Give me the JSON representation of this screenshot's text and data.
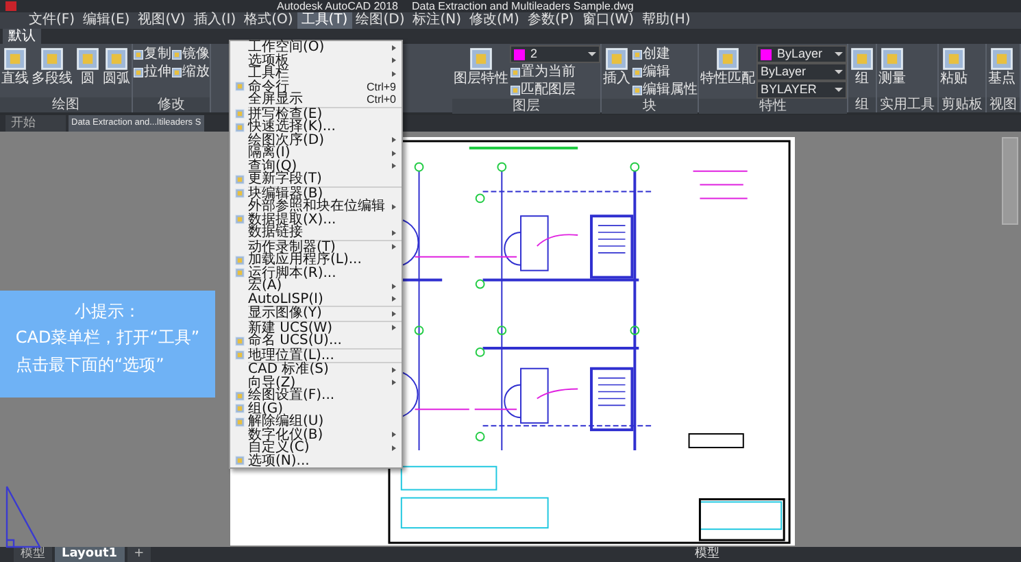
{
  "title_bar": {
    "app": "Autodesk AutoCAD 2018",
    "document": "Data Extraction and Multileaders Sample.dwg"
  },
  "menu_bar": [
    {
      "label": "文件(F)",
      "selected": false
    },
    {
      "label": "编辑(E)",
      "selected": false
    },
    {
      "label": "视图(V)",
      "selected": false
    },
    {
      "label": "插入(I)",
      "selected": false
    },
    {
      "label": "格式(O)",
      "selected": false
    },
    {
      "label": "工具(T)",
      "selected": true
    },
    {
      "label": "绘图(D)",
      "selected": false
    },
    {
      "label": "标注(N)",
      "selected": false
    },
    {
      "label": "修改(M)",
      "selected": false
    },
    {
      "label": "参数(P)",
      "selected": false
    },
    {
      "label": "窗口(W)",
      "selected": false
    },
    {
      "label": "帮助(H)",
      "selected": false
    }
  ],
  "ribbon": {
    "tabs": [
      {
        "label": "默认",
        "selected": true
      }
    ],
    "left_panels": [
      {
        "title": "绘图",
        "columns": [
          [
            {
              "kind": "large",
              "label": "直线"
            }
          ],
          [
            {
              "kind": "large",
              "label": "多段线"
            }
          ],
          [
            {
              "kind": "large",
              "label": "圆"
            }
          ],
          [
            {
              "kind": "large",
              "label": "圆弧"
            }
          ]
        ]
      },
      {
        "title": "修改",
        "columns": [
          [
            {
              "kind": "small",
              "label": "复制"
            },
            {
              "kind": "small",
              "label": "拉伸"
            }
          ],
          [
            {
              "kind": "small",
              "label": "镜像"
            },
            {
              "kind": "small",
              "label": "缩放"
            }
          ]
        ]
      }
    ],
    "right_panels": [
      {
        "title": "图层",
        "columns": [
          [
            {
              "kind": "large",
              "label": "图层特性"
            }
          ],
          [
            {
              "kind": "dropdown",
              "label": "2",
              "color": "#ff00ff"
            },
            {
              "kind": "small",
              "label": "置为当前"
            },
            {
              "kind": "small",
              "label": "匹配图层"
            }
          ]
        ]
      },
      {
        "title": "块",
        "columns": [
          [
            {
              "kind": "large",
              "label": "插入"
            }
          ],
          [
            {
              "kind": "small",
              "label": "创建"
            },
            {
              "kind": "small",
              "label": "编辑"
            },
            {
              "kind": "small",
              "label": "编辑属性"
            }
          ]
        ]
      },
      {
        "title": "特性",
        "columns": [
          [
            {
              "kind": "large",
              "label": "特性匹配"
            }
          ],
          [
            {
              "kind": "dropdown",
              "label": "ByLayer",
              "color": "#ff00ff"
            },
            {
              "kind": "dropdown",
              "label": "ByLayer"
            },
            {
              "kind": "dropdown",
              "label": "BYLAYER"
            }
          ]
        ]
      },
      {
        "title": "组",
        "columns": [
          [
            {
              "kind": "large",
              "label": "组"
            }
          ]
        ]
      },
      {
        "title": "实用工具",
        "columns": [
          [
            {
              "kind": "large",
              "label": "测量"
            }
          ]
        ]
      },
      {
        "title": "剪贴板",
        "columns": [
          [
            {
              "kind": "large",
              "label": "粘贴"
            }
          ]
        ]
      },
      {
        "title": "视图",
        "columns": [
          [
            {
              "kind": "large",
              "label": "基点"
            }
          ]
        ]
      }
    ]
  },
  "doc_tabs": [
    {
      "label": "开始",
      "selected": false
    },
    {
      "label": "Data Extraction and...ltileaders S",
      "selected": true
    }
  ],
  "tools_menu": {
    "groups": [
      [
        {
          "label": "工作空间(O)",
          "submenu": true,
          "has_icon": false
        },
        {
          "label": "选项板",
          "submenu": true,
          "has_icon": false
        },
        {
          "label": "工具栏",
          "submenu": true,
          "has_icon": false
        },
        {
          "label": "命令行",
          "shortcut": "Ctrl+9",
          "submenu": false,
          "has_icon": true
        },
        {
          "label": "全屏显示",
          "shortcut": "Ctrl+0",
          "submenu": false,
          "has_icon": false
        }
      ],
      [
        {
          "label": "拼写检查(E)",
          "submenu": false,
          "has_icon": true
        },
        {
          "label": "快速选择(K)...",
          "submenu": false,
          "has_icon": true
        },
        {
          "label": "绘图次序(D)",
          "submenu": true,
          "has_icon": false
        },
        {
          "label": "隔离(I)",
          "submenu": true,
          "has_icon": false
        },
        {
          "label": "查询(Q)",
          "submenu": true,
          "has_icon": false
        },
        {
          "label": "更新字段(T)",
          "submenu": false,
          "has_icon": true
        }
      ],
      [
        {
          "label": "块编辑器(B)",
          "submenu": false,
          "has_icon": true
        },
        {
          "label": "外部参照和块在位编辑",
          "submenu": true,
          "has_icon": false
        },
        {
          "label": "数据提取(X)...",
          "submenu": false,
          "has_icon": true
        },
        {
          "label": "数据链接",
          "submenu": true,
          "has_icon": false
        }
      ],
      [
        {
          "label": "动作录制器(T)",
          "submenu": true,
          "has_icon": false
        },
        {
          "label": "加载应用程序(L)...",
          "submenu": false,
          "has_icon": true
        },
        {
          "label": "运行脚本(R)...",
          "submenu": false,
          "has_icon": true
        },
        {
          "label": "宏(A)",
          "submenu": true,
          "has_icon": false
        },
        {
          "label": "AutoLISP(I)",
          "submenu": true,
          "has_icon": false
        }
      ],
      [
        {
          "label": "显示图像(Y)",
          "submenu": true,
          "has_icon": false
        }
      ],
      [
        {
          "label": "新建 UCS(W)",
          "submenu": true,
          "has_icon": false
        },
        {
          "label": "命名 UCS(U)...",
          "submenu": false,
          "has_icon": true
        }
      ],
      [
        {
          "label": "地理位置(L)...",
          "submenu": false,
          "has_icon": true
        }
      ],
      [
        {
          "label": "CAD 标准(S)",
          "submenu": true,
          "has_icon": false
        },
        {
          "label": "向导(Z)",
          "submenu": true,
          "has_icon": false
        },
        {
          "label": "绘图设置(F)...",
          "submenu": false,
          "has_icon": true
        },
        {
          "label": "组(G)",
          "submenu": false,
          "has_icon": true
        },
        {
          "label": "解除编组(U)",
          "submenu": false,
          "has_icon": true
        },
        {
          "label": "数字化仪(B)",
          "submenu": true,
          "has_icon": false
        },
        {
          "label": "自定义(C)",
          "submenu": true,
          "has_icon": false
        },
        {
          "label": "选项(N)...",
          "submenu": false,
          "has_icon": true
        }
      ]
    ]
  },
  "hint": {
    "title": "小提示：",
    "lines": [
      "CAD菜单栏，打开“工具”",
      "点击最下面的“选项”"
    ]
  },
  "layout_tabs": [
    {
      "label": "模型",
      "selected": false
    },
    {
      "label": "Layout1",
      "selected": true
    }
  ],
  "add_layout_label": "+",
  "status_bar": {
    "mode": "模型"
  }
}
